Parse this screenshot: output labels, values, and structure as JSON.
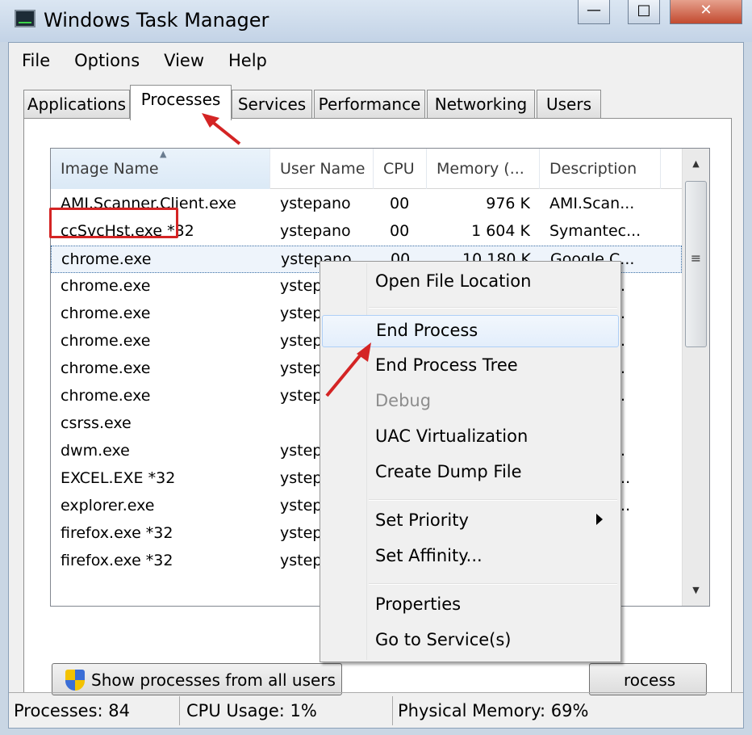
{
  "window": {
    "title": "Windows Task Manager",
    "minimize": "—",
    "maximize": "□",
    "close": "✕"
  },
  "menu": [
    "File",
    "Options",
    "View",
    "Help"
  ],
  "tabs": [
    "Applications",
    "Processes",
    "Services",
    "Performance",
    "Networking",
    "Users"
  ],
  "active_tab": "Processes",
  "columns": [
    "Image Name",
    "User Name",
    "CPU",
    "Memory (...",
    "Description"
  ],
  "rows": [
    [
      "AMI.Scanner.Client.exe",
      "ystepano",
      "00",
      "976 K",
      "AMI.Scan..."
    ],
    [
      "ccSvcHst.exe *32",
      "ystepano",
      "00",
      "1 604 K",
      "Symantec..."
    ],
    [
      "chrome.exe",
      "ystepano",
      "00",
      "10 180 K",
      "Google C..."
    ],
    [
      "chrome.exe",
      "ystep",
      "",
      "",
      ".."
    ],
    [
      "chrome.exe",
      "ystep",
      "",
      "",
      ".."
    ],
    [
      "chrome.exe",
      "ystep",
      "",
      "",
      ".."
    ],
    [
      "chrome.exe",
      "ystep",
      "",
      "",
      ".."
    ],
    [
      "chrome.exe",
      "ystep",
      "",
      "",
      ".."
    ],
    [
      "csrss.exe",
      "",
      "",
      "",
      ""
    ],
    [
      "dwm.exe",
      "ystep",
      "",
      "",
      ".."
    ],
    [
      "EXCEL.EXE *32",
      "ystep",
      "",
      "",
      "..."
    ],
    [
      "explorer.exe",
      "ystep",
      "",
      "",
      "..."
    ],
    [
      "firefox.exe *32",
      "ystep",
      "",
      "",
      ""
    ],
    [
      "firefox.exe *32",
      "ystep",
      "",
      "",
      ""
    ]
  ],
  "buttons": {
    "show_all": "Show processes from all users",
    "end_process": "rocess"
  },
  "status": {
    "processes": "Processes: 84",
    "cpu": "CPU Usage: 1%",
    "memory": "Physical Memory: 69%"
  },
  "context_menu": [
    "Open File Location",
    "End Process",
    "End Process Tree",
    "Debug",
    "UAC Virtualization",
    "Create Dump File",
    "Set Priority",
    "Set Affinity...",
    "Properties",
    "Go to Service(s)"
  ],
  "colors": {
    "annotation": "#d42424",
    "selection": "#3a6ea5"
  }
}
